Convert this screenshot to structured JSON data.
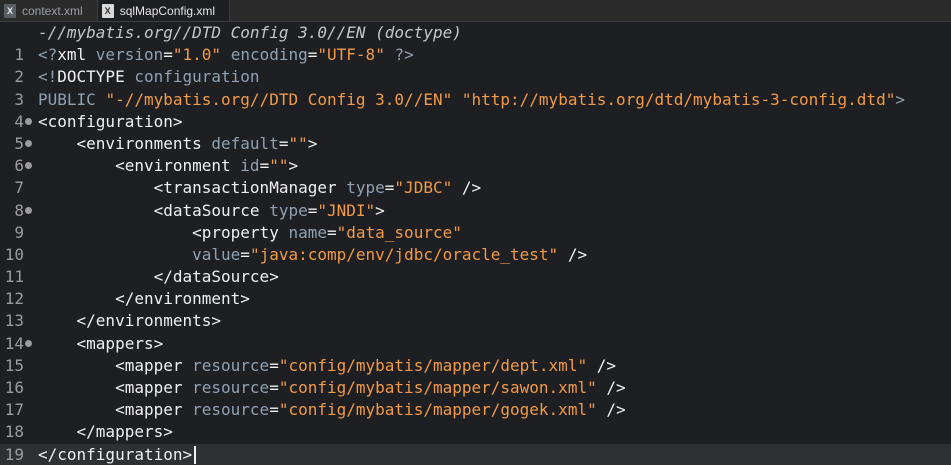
{
  "tabs": [
    {
      "icon": "X",
      "label": "context.xml",
      "active": false
    },
    {
      "icon": "X",
      "label": "sqlMapConfig.xml",
      "active": true
    }
  ],
  "editor": {
    "header_line": "-//mybatis.org//DTD Config 3.0//EN (doctype)",
    "lines": [
      {
        "num": "1",
        "fold": false,
        "segments": [
          [
            "proc",
            "<?"
          ],
          [
            "kw",
            "xml "
          ],
          [
            "attr",
            "version"
          ],
          [
            "kw",
            "="
          ],
          [
            "str",
            "\"1.0\""
          ],
          [
            "kw",
            " "
          ],
          [
            "attr",
            "encoding"
          ],
          [
            "kw",
            "="
          ],
          [
            "str",
            "\"UTF-8\""
          ],
          [
            "kw",
            " "
          ],
          [
            "proc",
            "?>"
          ]
        ]
      },
      {
        "num": "2",
        "fold": false,
        "segments": [
          [
            "proc",
            "<!"
          ],
          [
            "kw",
            "DOCTYPE "
          ],
          [
            "attr",
            "configuration"
          ]
        ]
      },
      {
        "num": "3",
        "fold": false,
        "segments": [
          [
            "attr",
            "PUBLIC "
          ],
          [
            "str",
            "\"-//mybatis.org//DTD Config 3.0//EN\""
          ],
          [
            "kw",
            " "
          ],
          [
            "str",
            "\"http://mybatis.org/dtd/mybatis-3-config.dtd\""
          ],
          [
            "attr",
            ">"
          ]
        ]
      },
      {
        "num": "4",
        "fold": true,
        "segments": [
          [
            "tag",
            "<configuration>"
          ]
        ]
      },
      {
        "num": "5",
        "fold": true,
        "segments": [
          [
            "tag",
            "    <environments "
          ],
          [
            "attr",
            "default"
          ],
          [
            "tag",
            "="
          ],
          [
            "str",
            "\"\""
          ],
          [
            "tag",
            ">"
          ]
        ]
      },
      {
        "num": "6",
        "fold": true,
        "segments": [
          [
            "tag",
            "        <environment "
          ],
          [
            "attr",
            "id"
          ],
          [
            "tag",
            "="
          ],
          [
            "str",
            "\"\""
          ],
          [
            "tag",
            ">"
          ]
        ]
      },
      {
        "num": "7",
        "fold": false,
        "segments": [
          [
            "tag",
            "            <transactionManager "
          ],
          [
            "attr",
            "type"
          ],
          [
            "tag",
            "="
          ],
          [
            "str",
            "\"JDBC\""
          ],
          [
            "tag",
            " />"
          ]
        ]
      },
      {
        "num": "8",
        "fold": true,
        "segments": [
          [
            "tag",
            "            <dataSource "
          ],
          [
            "attr",
            "type"
          ],
          [
            "tag",
            "="
          ],
          [
            "str",
            "\"JNDI\""
          ],
          [
            "tag",
            ">"
          ]
        ]
      },
      {
        "num": "9",
        "fold": false,
        "segments": [
          [
            "tag",
            "                <property "
          ],
          [
            "attr",
            "name"
          ],
          [
            "tag",
            "="
          ],
          [
            "str",
            "\"data_source\""
          ]
        ]
      },
      {
        "num": "10",
        "fold": false,
        "segments": [
          [
            "tag",
            "                "
          ],
          [
            "attr",
            "value"
          ],
          [
            "tag",
            "="
          ],
          [
            "str",
            "\"java:comp/env/jdbc/oracle_test\""
          ],
          [
            "tag",
            " />"
          ]
        ]
      },
      {
        "num": "11",
        "fold": false,
        "segments": [
          [
            "tag",
            "            </dataSource>"
          ]
        ]
      },
      {
        "num": "12",
        "fold": false,
        "segments": [
          [
            "tag",
            "        </environment>"
          ]
        ]
      },
      {
        "num": "13",
        "fold": false,
        "segments": [
          [
            "tag",
            "    </environments>"
          ]
        ]
      },
      {
        "num": "14",
        "fold": true,
        "segments": [
          [
            "tag",
            "    <mappers>"
          ]
        ]
      },
      {
        "num": "15",
        "fold": false,
        "segments": [
          [
            "tag",
            "        <mapper "
          ],
          [
            "attr",
            "resource"
          ],
          [
            "tag",
            "="
          ],
          [
            "str",
            "\"config/mybatis/mapper/dept.xml\""
          ],
          [
            "tag",
            " />"
          ]
        ]
      },
      {
        "num": "16",
        "fold": false,
        "segments": [
          [
            "tag",
            "        <mapper "
          ],
          [
            "attr",
            "resource"
          ],
          [
            "tag",
            "="
          ],
          [
            "str",
            "\"config/mybatis/mapper/sawon.xml\""
          ],
          [
            "tag",
            " />"
          ]
        ]
      },
      {
        "num": "17",
        "fold": false,
        "segments": [
          [
            "tag",
            "        <mapper "
          ],
          [
            "attr",
            "resource"
          ],
          [
            "tag",
            "="
          ],
          [
            "str",
            "\"config/mybatis/mapper/gogek.xml\""
          ],
          [
            "tag",
            " />"
          ]
        ]
      },
      {
        "num": "18",
        "fold": false,
        "segments": [
          [
            "tag",
            "    </mappers>"
          ]
        ]
      },
      {
        "num": "19",
        "fold": false,
        "current": true,
        "segments": [
          [
            "tag",
            "</configuration>"
          ]
        ]
      }
    ]
  }
}
